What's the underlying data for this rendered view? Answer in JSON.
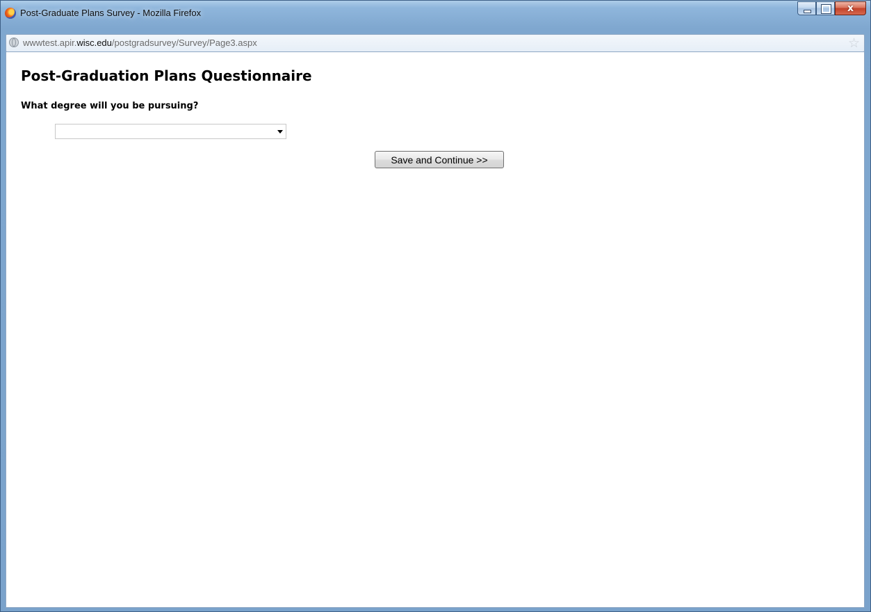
{
  "window": {
    "title": "Post-Graduate Plans Survey - Mozilla Firefox",
    "icon": "firefox-icon",
    "controls": [
      "minimize",
      "maximize",
      "close"
    ],
    "close_glyph": "x"
  },
  "address_bar": {
    "url_prefix": "wwwtest.apir.",
    "url_domain": "wisc.edu",
    "url_path": "/postgradsurvey/Survey/Page3.aspx",
    "left_icon": "globe-icon",
    "right_icon": "bookmark-star-icon"
  },
  "page": {
    "title": "Post-Graduation Plans Questionnaire",
    "question": "What degree will you be pursuing?",
    "degree_select": {
      "selected_value": ""
    },
    "save_button_label": "Save and Continue >>"
  }
}
